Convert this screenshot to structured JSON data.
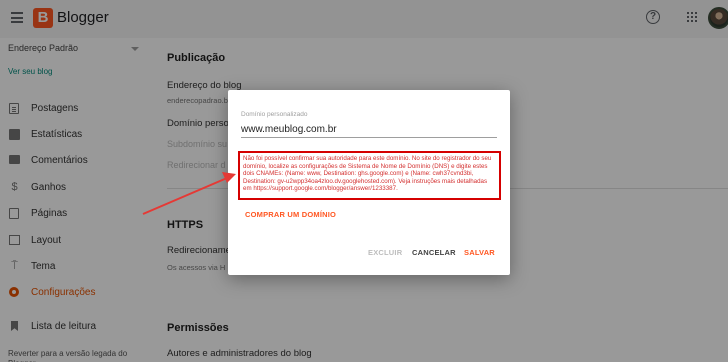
{
  "header": {
    "brand": "Blogger",
    "logo_letter": "B"
  },
  "sidebar": {
    "blog_name": "Endereço Padrão",
    "view_blog": "Ver seu blog",
    "items": [
      {
        "label": "Postagens",
        "icon": "posts-icon"
      },
      {
        "label": "Estatísticas",
        "icon": "stats-icon"
      },
      {
        "label": "Comentários",
        "icon": "comments-icon"
      },
      {
        "label": "Ganhos",
        "icon": "dollar-icon"
      },
      {
        "label": "Páginas",
        "icon": "pages-icon"
      },
      {
        "label": "Layout",
        "icon": "layout-icon"
      },
      {
        "label": "Tema",
        "icon": "theme-icon"
      },
      {
        "label": "Configurações",
        "icon": "gear-icon",
        "active": true
      },
      {
        "label": "Lista de leitura",
        "icon": "bookmark-icon"
      }
    ],
    "revert": "Reverter para a versão legada do Blogger"
  },
  "main": {
    "publicacao": {
      "title": "Publicação",
      "blog_address_title": "Endereço do blog",
      "blog_address_value": "enderecopadrao.b",
      "custom_domain_title": "Domínio perso",
      "subdomain": "Subdomínio su",
      "redirect_domain": "Redirecionar d"
    },
    "https": {
      "title": "HTTPS",
      "redirect_title": "Redirecionamen",
      "redirect_sub": "Os acessos via H"
    },
    "permissoes": {
      "title": "Permissões",
      "authors_title": "Autores e administradores do blog"
    }
  },
  "dialog": {
    "field_label": "Domínio personalizado",
    "field_value": "www.meublog.com.br",
    "error_message": "Não foi possível confirmar sua autoridade para este domínio. No site do registrador do seu domínio, localize as configurações de Sistema de Nome de Domínio (DNS) e digite estes dois CNAMEs: (Name: www, Destination: ghs.google.com) e (Name: cwh37cvnd3bi, Destination: gv-u2wpp34oa4zloo.dv.googlehosted.com). Veja instruções mais detalhadas em https://support.google.com/blogger/answer/1233387.",
    "buy_domain": "COMPRAR UM DOMÍNIO",
    "delete": "EXCLUIR",
    "cancel": "CANCELAR",
    "save": "SALVAR"
  },
  "colors": {
    "accent": "#ff5722",
    "error": "#d50000",
    "annotation_arrow": "#e53935"
  }
}
